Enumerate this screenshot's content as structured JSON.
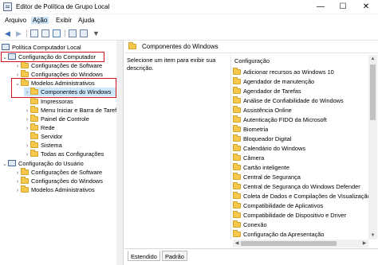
{
  "window": {
    "title": "Editor de Política de Grupo Local",
    "min": "—",
    "max": "☐",
    "close": "✕"
  },
  "menu": [
    {
      "label": "Arquivo"
    },
    {
      "label": "Ação"
    },
    {
      "label": "Exibir"
    },
    {
      "label": "Ajuda"
    }
  ],
  "tree": {
    "root": "Política Computador Local",
    "computer_config": "Configuração do Computador",
    "software_settings": "Configurações de Software",
    "windows_settings": "Configurações do Windows",
    "admin_templates": "Modelos Administrativos",
    "windows_components": "Componentes do Windows",
    "printers": "Impressoras",
    "start_menu": "Menu Iniciar e Barra de Tarefas",
    "control_panel": "Painel de Controle",
    "network": "Rede",
    "server": "Servidor",
    "system": "Sistema",
    "all_settings": "Todas as Configurações",
    "user_config": "Configuração do Usuário",
    "user_software": "Configurações de Software",
    "user_windows": "Configurações do Windows",
    "user_admin": "Modelos Administrativos"
  },
  "right": {
    "header": "Componentes do Windows",
    "description": "Selecione um item para exibir sua descrição.",
    "column": "Configuração",
    "items": [
      "Adicionar recursos ao Windows 10",
      "Agendador de manutenção",
      "Agendador de Tarefas",
      "Análise de Confiabilidade do Windows",
      "Assistência Online",
      "Autenticação FIDO da Microsoft",
      "Biometria",
      "Bloqueador Digital",
      "Calendário do Windows",
      "Câmera",
      "Cartão inteligente",
      "Central de Segurança",
      "Central de Segurança do Windows Defender",
      "Coleta de Dados e Compilações de Visualização",
      "Compatibilidade de Aplicativos",
      "Compatibilidade de Dispositivo e Driver",
      "Conexão",
      "Configuração da Apresentação"
    ]
  },
  "tabs": [
    {
      "label": "Estendido"
    },
    {
      "label": "Padrão"
    }
  ]
}
